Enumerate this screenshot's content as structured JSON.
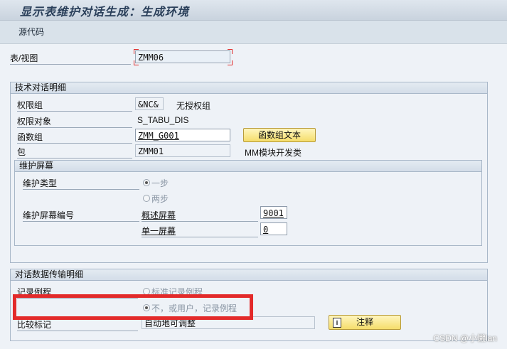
{
  "window": {
    "title": "显示表维护对话生成：生成环境"
  },
  "toolbar": {
    "source_code_label": "源代码"
  },
  "main": {
    "table_view_label": "表/视图",
    "table_view_value": "ZMM06"
  },
  "tech_group": {
    "title": "技术对话明细",
    "auth_group_label": "权限组",
    "auth_group_value": "&NC&",
    "auth_group_desc": "无授权组",
    "auth_object_label": "权限对象",
    "auth_object_value": "S_TABU_DIS",
    "function_group_label": "函数组",
    "function_group_value": "ZMM_G001",
    "function_group_button": "函数组文本",
    "package_label": "包",
    "package_value": "ZMM01",
    "package_desc": "MM模块开发类"
  },
  "maint_screen": {
    "title": "维护屏幕",
    "type_label": "维护类型",
    "one_step_label": "一步",
    "two_step_label": "两步",
    "one_step_selected": true,
    "screen_number_label": "维护屏幕编号",
    "overview_label": "概述屏幕",
    "overview_value": "9001",
    "single_label": "单一屏幕",
    "single_value": "0"
  },
  "transport_group": {
    "title": "对话数据传输明细",
    "record_routine_label": "记录例程",
    "standard_routine_label": "标准记录例程",
    "no_user_routine_label": "不，或用户，记录例程",
    "no_user_selected": true,
    "compare_flag_label": "比较标记",
    "compare_flag_value": "自动地可调整",
    "comment_button_label": "注释",
    "comment_icon": "info-icon"
  },
  "overlay": {
    "watermark": "CSDN @小懒lan",
    "highlight_color": "#e32a2a"
  }
}
